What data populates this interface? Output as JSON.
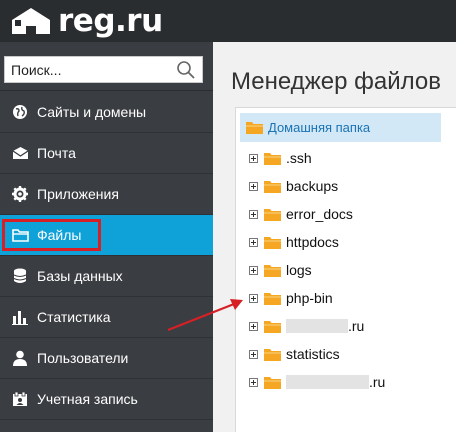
{
  "brand": {
    "logo_text": "reg.ru"
  },
  "search": {
    "placeholder": "Поиск..."
  },
  "sidebar": {
    "items": [
      {
        "label": "Сайты и домены",
        "icon": "globe-icon"
      },
      {
        "label": "Почта",
        "icon": "mail-icon"
      },
      {
        "label": "Приложения",
        "icon": "gear-icon"
      },
      {
        "label": "Файлы",
        "icon": "folder-icon",
        "active": true
      },
      {
        "label": "Базы данных",
        "icon": "database-icon"
      },
      {
        "label": "Статистика",
        "icon": "bar-chart-icon"
      },
      {
        "label": "Пользователи",
        "icon": "user-icon"
      },
      {
        "label": "Учетная запись",
        "icon": "account-icon"
      }
    ]
  },
  "main": {
    "title": "Менеджер файлов",
    "tree": {
      "root": "Домашняя папка",
      "items": [
        ".ssh",
        "backups",
        "error_docs",
        "httpdocs",
        "logs",
        "php-bin",
        ".ru",
        "statistics",
        ".ru"
      ]
    }
  },
  "colors": {
    "header_bg": "#2a2d30",
    "sidebar_bg": "#3a3d41",
    "active_bg": "#0ea2d9",
    "highlight": "#d71f26",
    "folder": "#f5a623",
    "root_bg": "#d3e8f6",
    "root_text": "#1a73b5"
  }
}
